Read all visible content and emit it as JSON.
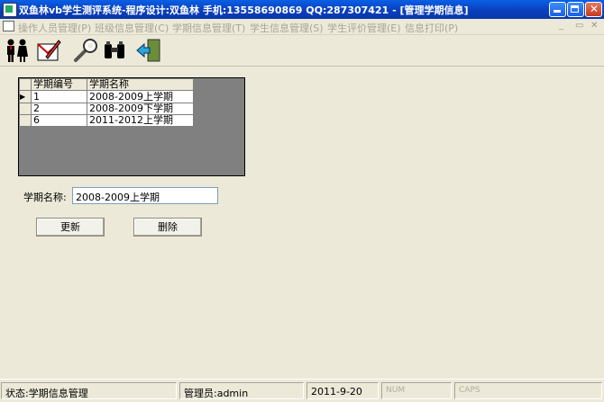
{
  "window": {
    "title": "双鱼林vb学生测评系统-程序设计:双鱼林 手机:13558690869 QQ:287307421 - [管理学期信息]"
  },
  "menu": {
    "items": [
      {
        "label": "操作人员管理(P)"
      },
      {
        "label": "班级信息管理(C)"
      },
      {
        "label": "学期信息管理(T)"
      },
      {
        "label": "学生信息管理(S)"
      },
      {
        "label": "学生评价管理(E)"
      },
      {
        "label": "信息打印(P)"
      }
    ]
  },
  "toolbar": {
    "icons": [
      "users-icon",
      "edit-icon",
      "wrench-icon",
      "binoculars-icon",
      "exit-door-icon"
    ]
  },
  "grid": {
    "columns": [
      "学期编号",
      "学期名称"
    ],
    "rows": [
      {
        "id": "1",
        "name": "2008-2009上学期"
      },
      {
        "id": "2",
        "name": "2008-2009下学期"
      },
      {
        "id": "6",
        "name": "2011-2012上学期"
      }
    ],
    "selected_row": 0
  },
  "form": {
    "term_label": "学期名称:",
    "term_value": "2008-2009上学期",
    "update_label": "更新",
    "delete_label": "删除"
  },
  "status": {
    "state": "状态:学期信息管理",
    "admin": "管理员:admin",
    "date": "2011-9-20",
    "num": "NUM",
    "caps": "CAPS"
  }
}
